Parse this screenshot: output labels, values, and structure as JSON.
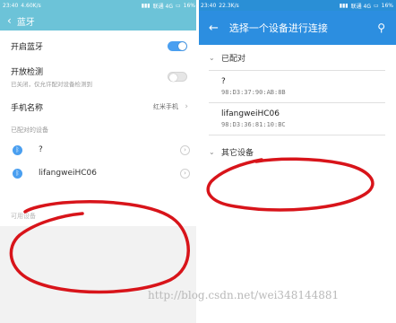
{
  "left": {
    "status": {
      "time": "23:40",
      "speed": "4.60K/s",
      "carrier": "联通 4G",
      "battery": "16%"
    },
    "title": "蓝牙",
    "bluetooth_toggle": {
      "label": "开启蓝牙",
      "on": true
    },
    "visibility": {
      "label": "开放检测",
      "sub": "已关闭，仅允许配对设备检测到",
      "on": false
    },
    "device_name": {
      "label": "手机名称",
      "value": "红米手机"
    },
    "paired_header": "已配对的设备",
    "paired_devices": [
      {
        "name": "?"
      },
      {
        "name": "lifangweiHC06"
      }
    ],
    "available_header": "可用设备"
  },
  "right": {
    "status": {
      "time": "23:40",
      "speed": "22.3K/s",
      "carrier": "联通 4G",
      "battery": "16%"
    },
    "title": "选择一个设备进行连接",
    "paired_section": "已配对",
    "devices": [
      {
        "name": "?",
        "mac": "98:D3:37:90:AB:8B"
      },
      {
        "name": "lifangweiHC06",
        "mac": "98:D3:36:81:10:BC"
      }
    ],
    "other_section": "其它设备"
  },
  "watermark": "http://blog.csdn.net/wei348144881",
  "colors": {
    "left_accent": "#6cc3d8",
    "right_accent": "#2c8ee0",
    "toggle_on": "#4a9ff0",
    "annotation": "#d8141a"
  }
}
